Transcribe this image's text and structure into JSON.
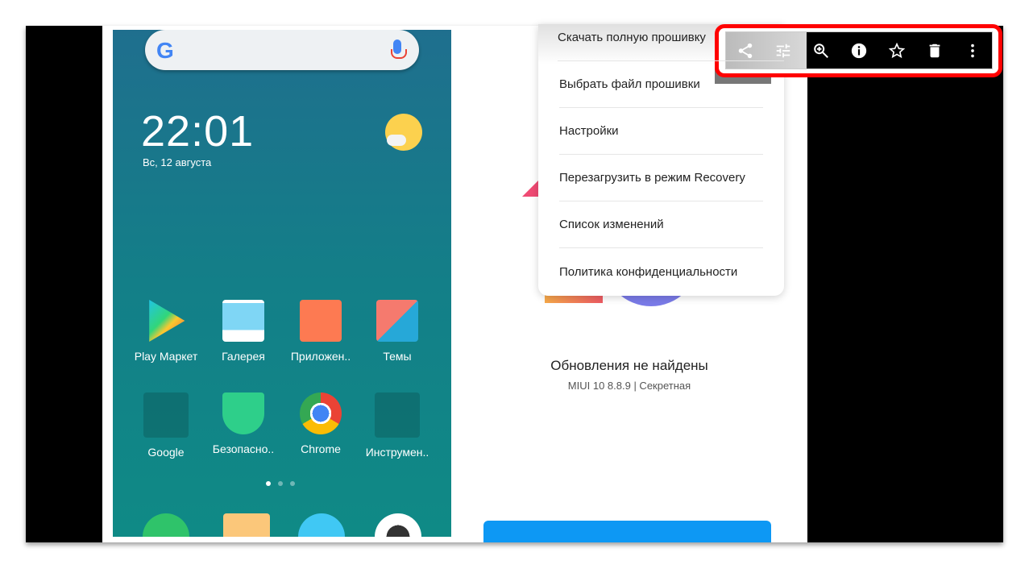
{
  "phone": {
    "clock": "22:01",
    "date": "Вс, 12 августа",
    "apps": [
      {
        "label": "Play Маркет",
        "icon": "play-store-icon"
      },
      {
        "label": "Галерея",
        "icon": "gallery-icon"
      },
      {
        "label": "Приложен..",
        "icon": "app-store-icon"
      },
      {
        "label": "Темы",
        "icon": "themes-icon"
      },
      {
        "label": "Google",
        "icon": "google-folder-icon"
      },
      {
        "label": "Безопасно..",
        "icon": "security-icon"
      },
      {
        "label": "Chrome",
        "icon": "chrome-icon"
      },
      {
        "label": "Инструмен..",
        "icon": "tools-folder-icon"
      }
    ],
    "page_indicator": {
      "pages": 3,
      "current": 1
    }
  },
  "menu": {
    "items": [
      "Скачать полную прошивку",
      "Выбрать файл прошивки",
      "Настройки",
      "Перезагрузить в режим Recovery",
      "Список изменений",
      "Политика конфиденциальности"
    ]
  },
  "updater": {
    "status": "Обновления не найдены",
    "version": "MIUI 10 8.8.9 | Секретная"
  },
  "toolbar": {
    "icons": [
      "share-icon",
      "adjust-icon",
      "zoom-in-icon",
      "info-icon",
      "star-icon",
      "delete-icon",
      "more-vert-icon"
    ],
    "highlight_color": "#ff0000"
  }
}
